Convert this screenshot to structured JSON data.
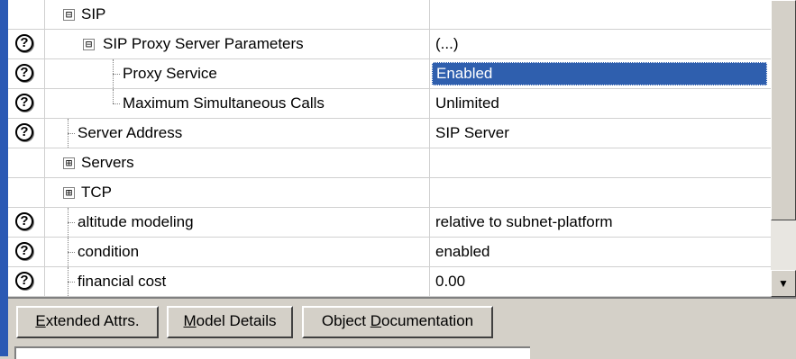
{
  "rows": [
    {
      "name": "SIP",
      "value": "",
      "help": false,
      "expand": "minus",
      "indent": 1
    },
    {
      "name": "SIP Proxy Server Parameters",
      "value": "(...)",
      "help": true,
      "expand": "minus",
      "indent": 2
    },
    {
      "name": "Proxy Service",
      "value": "Enabled",
      "help": true,
      "selected": true,
      "indent": 3
    },
    {
      "name": "Maximum Simultaneous Calls",
      "value": "Unlimited",
      "help": true,
      "indent": 3
    },
    {
      "name": "Server Address",
      "value": "SIP Server",
      "help": true,
      "indent": 1
    },
    {
      "name": "Servers",
      "value": "",
      "help": false,
      "expand": "plus",
      "indent": 1
    },
    {
      "name": "TCP",
      "value": "",
      "help": false,
      "expand": "plus",
      "indent": 1
    },
    {
      "name": "altitude modeling",
      "value": "relative to subnet-platform",
      "help": true,
      "indent": 1
    },
    {
      "name": "condition",
      "value": "enabled",
      "help": true,
      "indent": 1
    },
    {
      "name": "financial cost",
      "value": "0.00",
      "help": true,
      "indent": 1
    }
  ],
  "help_glyph": "?",
  "icons": {
    "expand_minus": "⊟",
    "expand_plus": "⊞",
    "scroll_down": "▼"
  },
  "buttons": {
    "extended": {
      "mnemonic": "E",
      "rest": "xtended Attrs."
    },
    "model": {
      "mnemonic": "M",
      "rest": "odel Details"
    },
    "object_doc": {
      "pre": "Object ",
      "mnemonic": "D",
      "rest": "ocumentation"
    }
  },
  "colors": {
    "selection": "#2f5fae",
    "window_bg": "#d4d0c8",
    "left_stripe": "#2b59b4"
  }
}
